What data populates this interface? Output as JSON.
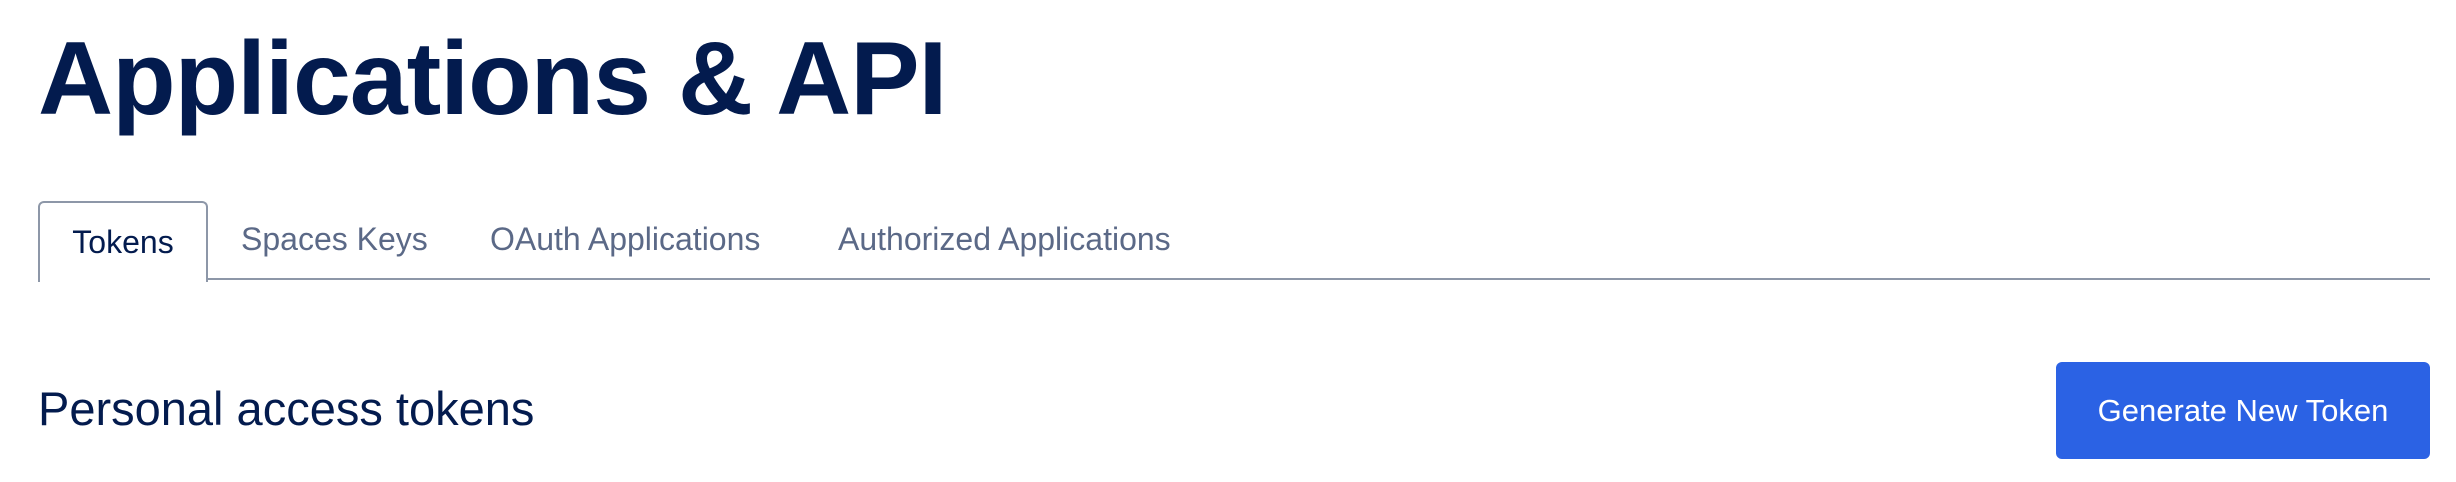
{
  "page": {
    "title": "Applications & API"
  },
  "tabs": [
    {
      "label": "Tokens",
      "active": true
    },
    {
      "label": "Spaces Keys",
      "active": false
    },
    {
      "label": "OAuth Applications",
      "active": false
    },
    {
      "label": "Authorized Applications",
      "active": false
    }
  ],
  "section": {
    "title": "Personal access tokens",
    "button_label": "Generate New Token"
  },
  "colors": {
    "text_primary": "#031b4e",
    "text_muted": "#5b6987",
    "border": "#8d97a8",
    "accent": "#2b62e4"
  }
}
